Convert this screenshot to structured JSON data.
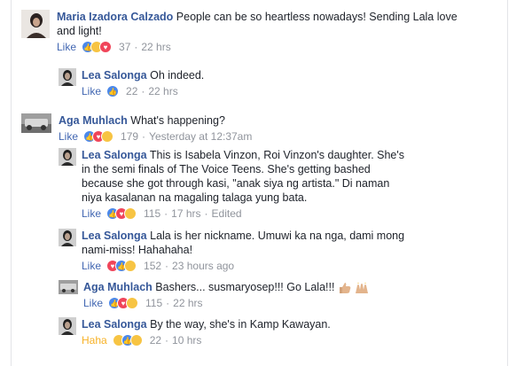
{
  "comments": [
    {
      "author": "Maria Izadora Calzado",
      "text": "People can be so heartless nowadays! Sending Lala love and light!",
      "action": "Like",
      "reactions": [
        "like",
        "sad",
        "love"
      ],
      "count": "37",
      "time": "22 hrs"
    },
    {
      "author": "Lea Salonga",
      "text": "Oh indeed.",
      "action": "Like",
      "reactions": [
        "like"
      ],
      "count": "22",
      "time": "22 hrs"
    },
    {
      "author": "Aga Muhlach",
      "text": "What's happening?",
      "action": "Like",
      "reactions": [
        "like",
        "love",
        "haha"
      ],
      "count": "179",
      "time": "Yesterday at 12:37am"
    },
    {
      "author": "Lea Salonga",
      "text": "This is Isabela Vinzon, Roi Vinzon's daughter. She's in the semi finals of The Voice Teens. She's getting bashed because she got through kasi, \"anak siya ng artista.\" Di naman niya kasalanan na magaling talaga yung bata.",
      "action": "Like",
      "reactions": [
        "like",
        "love",
        "haha"
      ],
      "count": "115",
      "time": "17 hrs",
      "edited": "Edited"
    },
    {
      "author": "Lea Salonga",
      "text": "Lala is her nickname. Umuwi ka na nga, dami mong nami-miss! Hahahaha!",
      "action": "Like",
      "reactions": [
        "love",
        "like",
        "haha"
      ],
      "count": "152",
      "time": "23 hours ago"
    },
    {
      "author": "Aga Muhlach",
      "text": "Bashers... susmaryosep!!! Go Lala!!!",
      "action": "Like",
      "reactions": [
        "like",
        "love",
        "haha"
      ],
      "count": "115",
      "time": "22 hrs"
    },
    {
      "author": "Lea Salonga",
      "text": "By the way, she's in Kamp Kawayan.",
      "action": "Haha",
      "reactions": [
        "haha",
        "like",
        "wow"
      ],
      "count": "22",
      "time": "10 hrs"
    }
  ],
  "colors": {
    "author": "#365899",
    "like": "#4267b2",
    "haha": "#f7b125",
    "meta": "#90949c"
  }
}
